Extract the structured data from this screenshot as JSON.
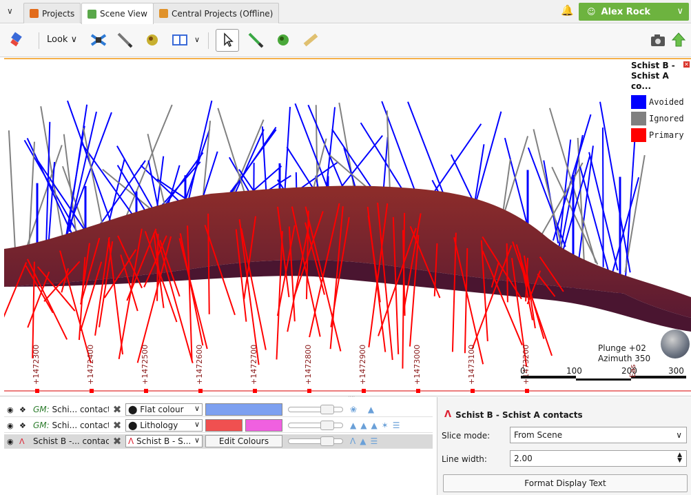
{
  "tabs": [
    {
      "label": "Projects",
      "icon": "projects-grid-icon",
      "color": "#e26b1a"
    },
    {
      "label": "Scene View",
      "icon": "scene-cube-icon",
      "color": "#5aa84a"
    },
    {
      "label": "Central Projects (Offline)",
      "icon": "central-cube-icon",
      "color": "#e0922a"
    }
  ],
  "user": {
    "name": "Alex Rock",
    "color": "#6db33f"
  },
  "toolbar": {
    "look_label": "Look"
  },
  "legend": {
    "title_line1": "Schist B -",
    "title_line2": "Schist A co...",
    "items": [
      {
        "label": "Avoided",
        "color": "#0000ff"
      },
      {
        "label": "Ignored",
        "color": "#808080"
      },
      {
        "label": "Primary",
        "color": "#ff0000"
      }
    ]
  },
  "axis": {
    "northing_labels": [
      "+1472300",
      "+1472400",
      "+1472500",
      "+1472600",
      "+1472700",
      "+1472800",
      "+1472900",
      "+1473000",
      "+1473100",
      "+1473200"
    ],
    "easting_label": "Eas"
  },
  "orientation": {
    "plunge": "Plunge +02",
    "azimuth": "Azimuth 350",
    "scale_labels": [
      "0",
      "100",
      "200",
      "300"
    ]
  },
  "layers": [
    {
      "prefix": "GM:",
      "name": "Schi... contacts",
      "mode": "Flat colour",
      "swatches": [
        "#7da0f0"
      ]
    },
    {
      "prefix": "GM:",
      "name": "Schi... contacts",
      "mode": "Lithology",
      "swatches": [
        "#f05050",
        "#f060e0"
      ]
    },
    {
      "prefix": "",
      "name": "Schist B -... contacts",
      "mode": "Schist B - S...",
      "edit_label": "Edit Colours"
    }
  ],
  "properties": {
    "title": "Schist B - Schist A contacts",
    "slice_mode_label": "Slice mode:",
    "slice_mode_value": "From Scene",
    "line_width_label": "Line width:",
    "line_width_value": "2.00",
    "format_button": "Format Display Text"
  }
}
